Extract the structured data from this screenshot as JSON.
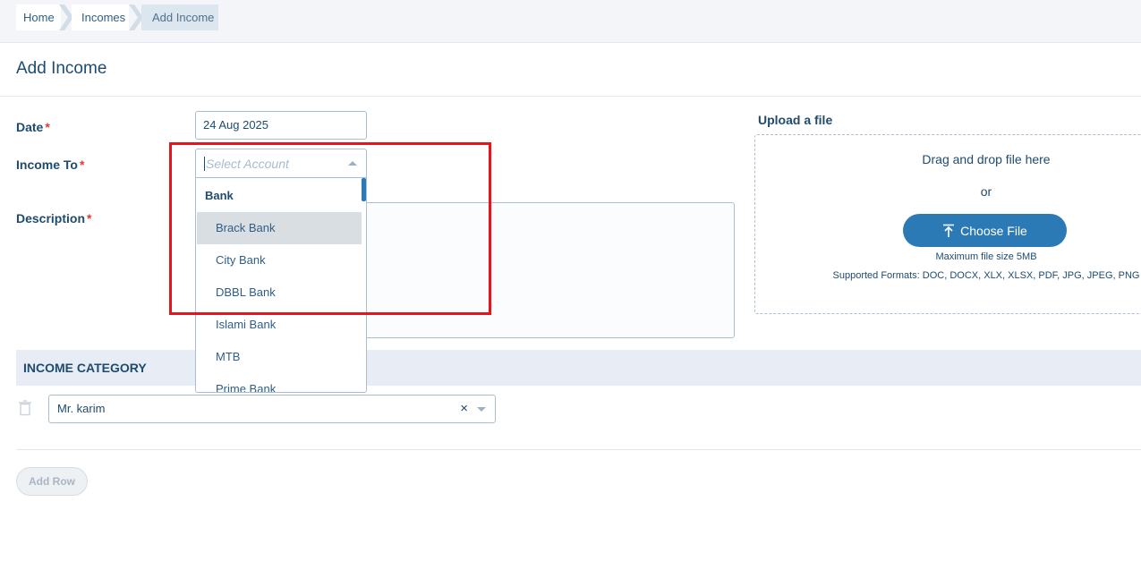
{
  "breadcrumb": {
    "items": [
      "Home",
      "Incomes",
      "Add Income"
    ]
  },
  "page": {
    "title": "Add Income"
  },
  "form": {
    "date": {
      "label": "Date",
      "required_mark": "*",
      "value": "24 Aug 2025"
    },
    "income_to": {
      "label": "Income To",
      "required_mark": "*",
      "placeholder": "Select Account",
      "dropdown": {
        "group": "Bank",
        "options": [
          "Brack Bank",
          "City Bank",
          "DBBL Bank",
          "Islami Bank",
          "MTB",
          "Prime Bank"
        ],
        "highlighted": "Brack Bank"
      }
    },
    "description": {
      "label": "Description",
      "required_mark": "*"
    }
  },
  "upload": {
    "title": "Upload a file",
    "drag_text": "Drag and drop file here",
    "or_text": "or",
    "button_label": "Choose File",
    "max_size": "Maximum file size 5MB",
    "formats": "Supported Formats: DOC, DOCX, XLX, XLSX, PDF, JPG, JPEG, PNG"
  },
  "category": {
    "header": "INCOME CATEGORY",
    "rows": [
      {
        "value": "Mr. karim",
        "clear": "×"
      }
    ],
    "add_row_label": "Add Row"
  },
  "colors": {
    "primary": "#2b7ab5",
    "text": "#1e4b6e",
    "required": "#e53935",
    "annotation": "#e8141a"
  }
}
